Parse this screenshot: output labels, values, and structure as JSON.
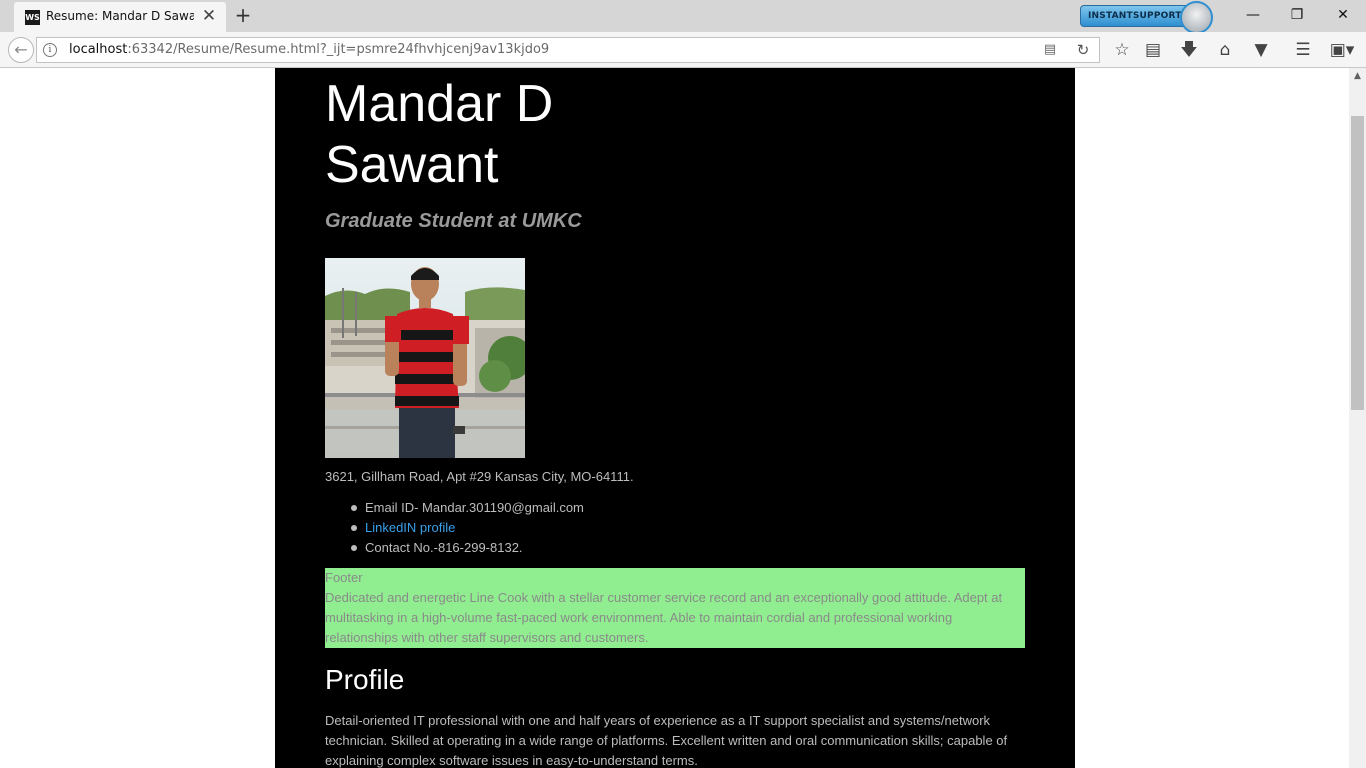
{
  "browser": {
    "tab_title": "Resume: Mandar D Sawant,",
    "tab_favicon": "WS",
    "tab_close": "✕",
    "new_tab": "+",
    "instant_support": "INSTANTSUPPORT",
    "url_host": "localhost",
    "url_rest": ":63342/Resume/Resume.html?_ijt=psmre24fhvhjcenj9av13kjdo9",
    "window_controls": {
      "minimize": "—",
      "restore": "❐",
      "close": "✕"
    },
    "icons": [
      "back-arrow-icon",
      "info-icon",
      "reader-view-icon",
      "reload-icon",
      "bookmark-star-icon",
      "reading-list-icon",
      "download-icon",
      "home-icon",
      "pocket-icon",
      "menu-icon",
      "extension-icon"
    ]
  },
  "resume": {
    "name": "Mandar D Sawant",
    "subtitle": "Graduate Student at UMKC",
    "address": "3621, Gillham Road, Apt #29 Kansas City, MO-64111.",
    "contacts": {
      "email": "Email ID- Mandar.301190@gmail.com",
      "linkedin": "LinkedIN profile",
      "phone": "Contact No.-816-299-8132."
    },
    "footer_label": "Footer",
    "footer_text": "Dedicated and energetic Line Cook with a stellar customer service record and an exceptionally good attitude. Adept at multitasking in a high-volume fast-paced work environment. Able to maintain cordial and professional working relationships with other staff supervisors and customers.",
    "profile_title": "Profile",
    "profile_text": "Detail-oriented IT professional with one and half years of experience as a IT support specialist and systems/network technician. Skilled at operating in a wide range of platforms. Excellent written and oral communication skills; capable of explaining complex software issues in easy-to-understand terms."
  },
  "colors": {
    "page_background": "#000000",
    "footer_background": "#90ee90",
    "link": "#3aa0e8"
  }
}
